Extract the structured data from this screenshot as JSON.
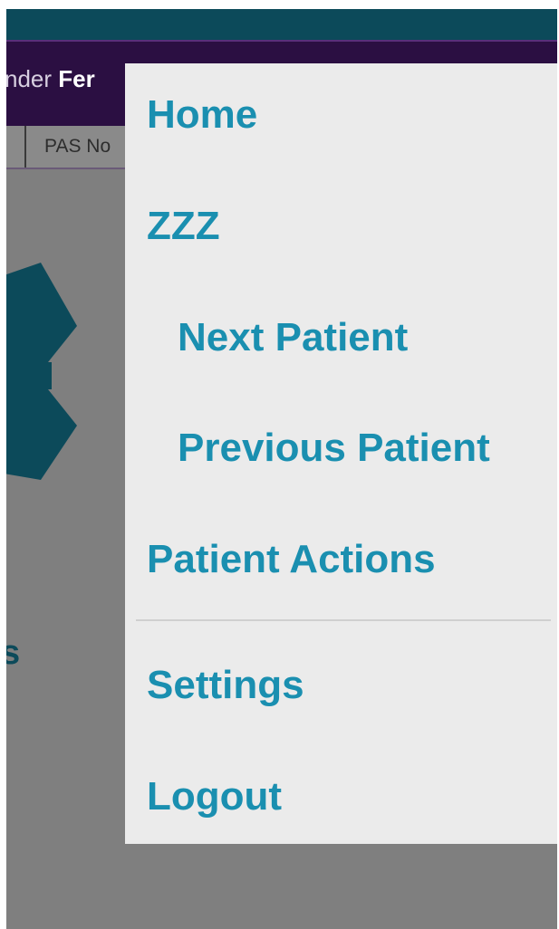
{
  "header": {
    "patient_name_prefix": "nder ",
    "patient_name_bold": "Fer",
    "info_label": "PAS No"
  },
  "background": {
    "heading_fragment": "s",
    "logo_icon": "hexagon-logo-icon"
  },
  "menu": {
    "items": [
      {
        "label": "Home"
      },
      {
        "label": "ZZZ"
      },
      {
        "label": "Next Patient"
      },
      {
        "label": "Previous Patient"
      },
      {
        "label": "Patient Actions"
      },
      {
        "label": "Settings"
      },
      {
        "label": "Logout"
      }
    ]
  },
  "colors": {
    "top_bar": "#0c4a5a",
    "patient_header": "#2b0f42",
    "menu_background": "#ebebeb",
    "menu_text": "#1a8fb0",
    "overlay": "#7f7f7f"
  }
}
